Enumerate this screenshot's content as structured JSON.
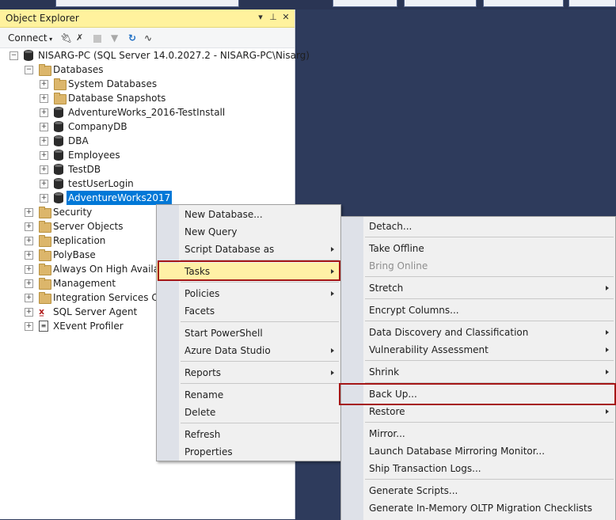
{
  "oe": {
    "title": "Object Explorer",
    "pin_icon": "pin-icon",
    "toolbar": {
      "connect": "Connect"
    }
  },
  "tree": {
    "root": "NISARG-PC (SQL Server 14.0.2027.2 - NISARG-PC\\Nisarg)",
    "databases": "Databases",
    "db_items": [
      "System Databases",
      "Database Snapshots",
      "AdventureWorks_2016-TestInstall",
      "CompanyDB",
      "DBA",
      "Employees",
      "TestDB",
      "testUserLogin",
      "AdventureWorks2017"
    ],
    "other_items": [
      "Security",
      "Server Objects",
      "Replication",
      "PolyBase",
      "Always On High Availabi",
      "Management",
      "Integration Services Cata",
      "SQL Server Agent",
      "XEvent Profiler"
    ]
  },
  "menu1": {
    "items": [
      "New Database...",
      "New Query",
      "Script Database as",
      "Tasks",
      "Policies",
      "Facets",
      "Start PowerShell",
      "Azure Data Studio",
      "Reports",
      "Rename",
      "Delete",
      "Refresh",
      "Properties"
    ]
  },
  "menu2": {
    "items": [
      "Detach...",
      "Take Offline",
      "Bring Online",
      "Stretch",
      "Encrypt Columns...",
      "Data Discovery and Classification",
      "Vulnerability Assessment",
      "Shrink",
      "Back Up...",
      "Restore",
      "Mirror...",
      "Launch Database Mirroring Monitor...",
      "Ship Transaction Logs...",
      "Generate Scripts...",
      "Generate In-Memory OLTP Migration Checklists"
    ]
  },
  "colors": {
    "background": "#2e3b5c",
    "title_bar": "#fff29d",
    "selection": "#0078d7",
    "menu_highlight": "#fff0a6",
    "annotation_box": "#a51616"
  }
}
